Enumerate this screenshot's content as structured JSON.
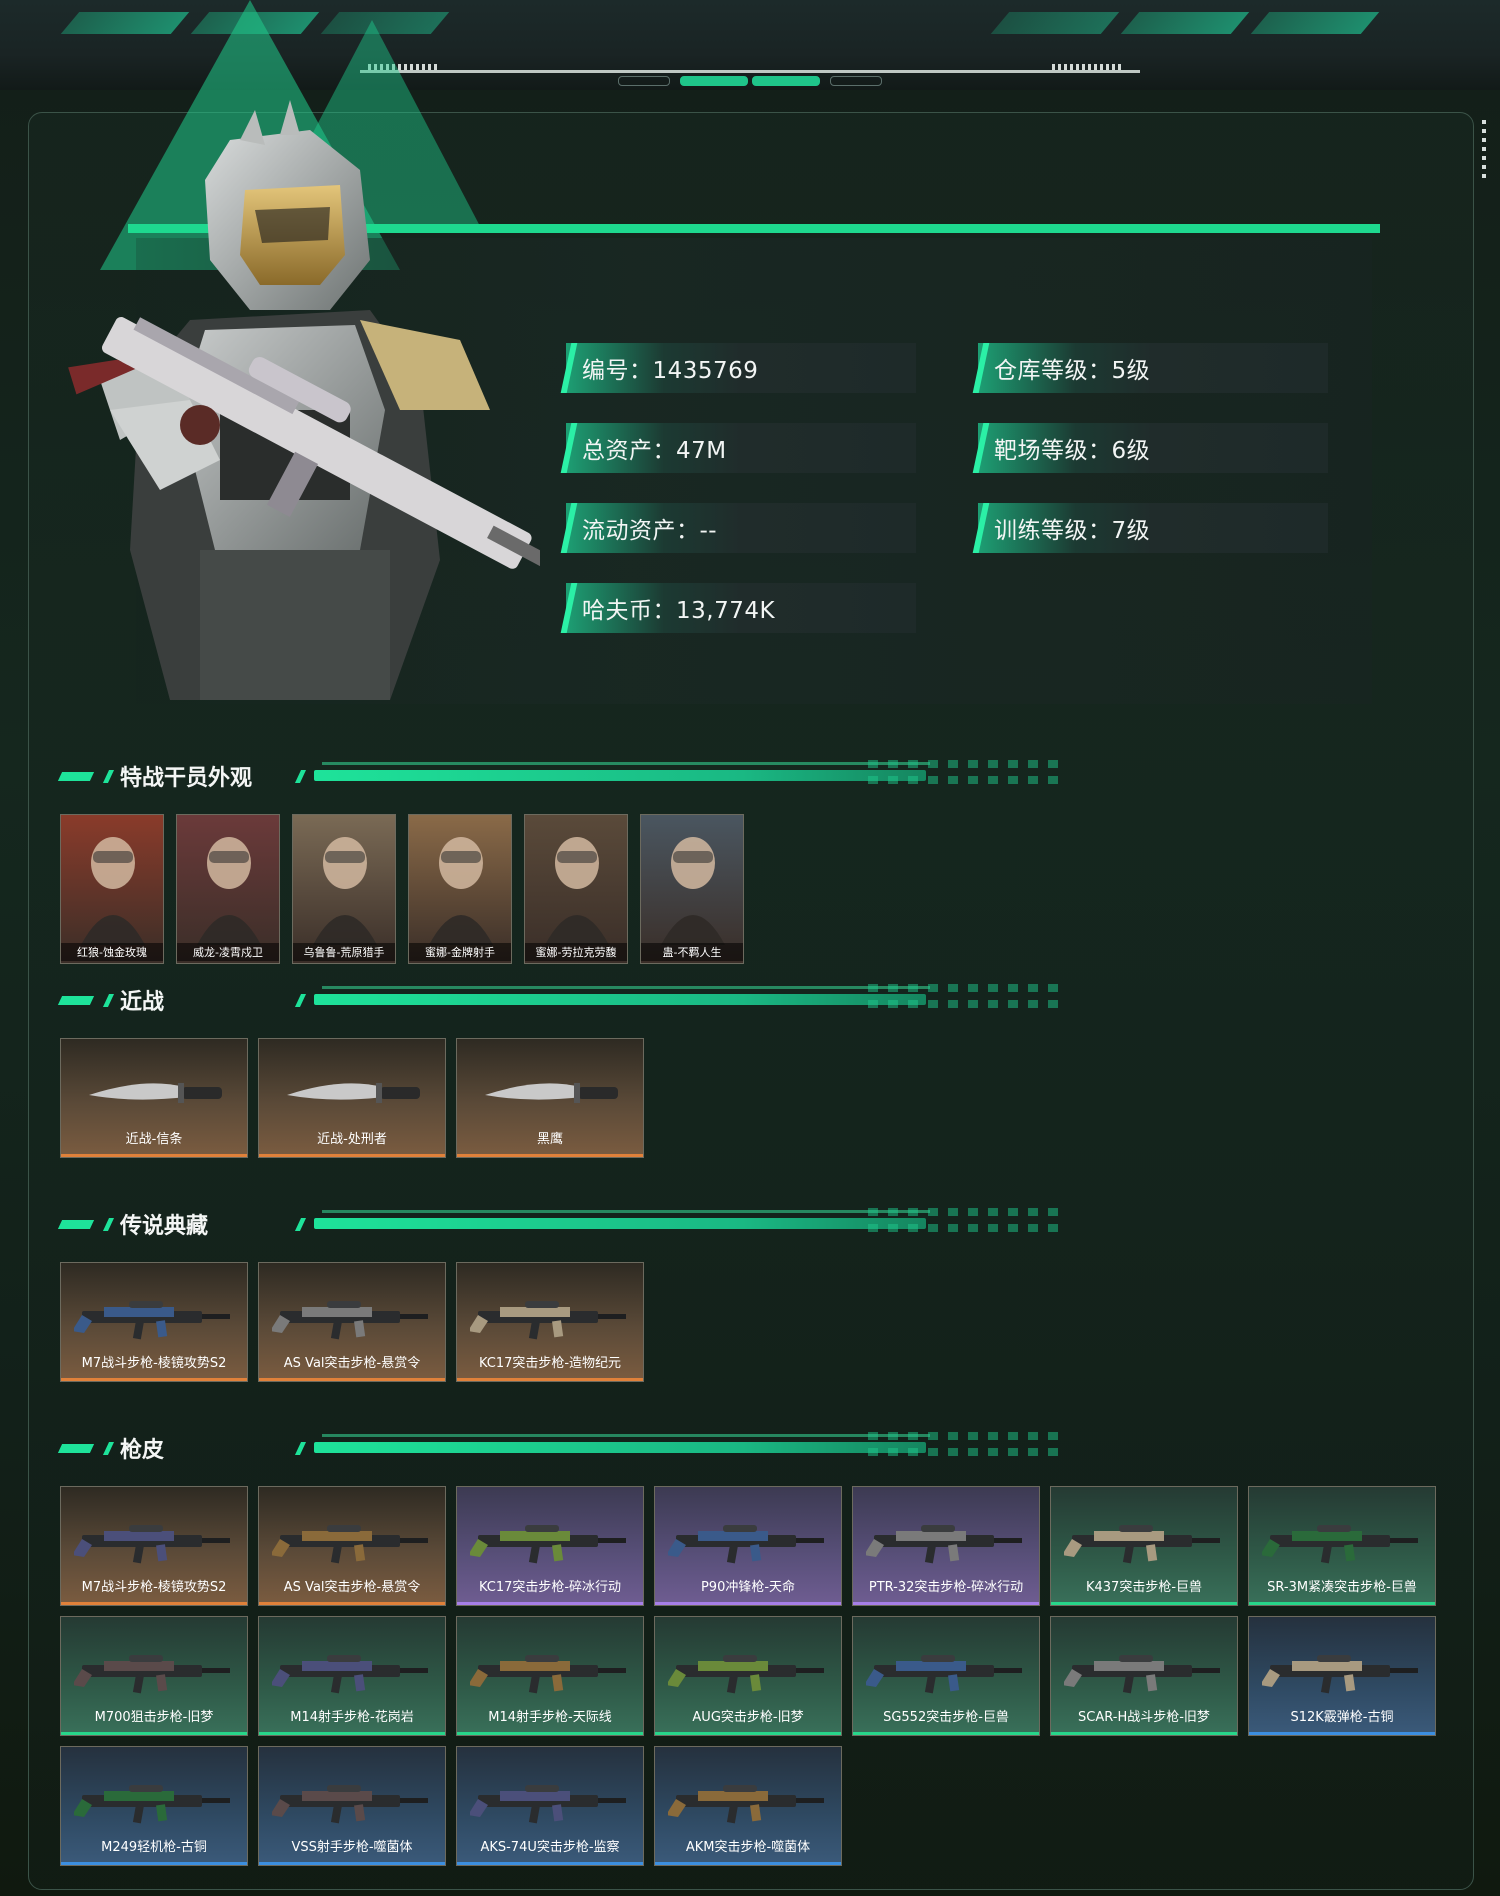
{
  "stats": {
    "id": "编号：1435769",
    "warehouse": "仓库等级：5级",
    "total_assets": "总资产：47M",
    "range": "靶场等级：6级",
    "liquid": "流动资产：--",
    "training": "训练等级：7级",
    "coins": "哈夫币：13,774K"
  },
  "sections": {
    "operators": "特战干员外观",
    "melee": "近战",
    "legend": "传说典藏",
    "skins": "枪皮"
  },
  "operators": [
    {
      "label": "红狼-蚀金玫瑰",
      "color": "#8a3b2a"
    },
    {
      "label": "威龙-凌霄戍卫",
      "color": "#6b3a3a"
    },
    {
      "label": "乌鲁鲁-荒原猎手",
      "color": "#7a6a55"
    },
    {
      "label": "蜜娜-金牌射手",
      "color": "#8a6a48"
    },
    {
      "label": "蜜娜-劳拉克劳馥",
      "color": "#5a4a3a"
    },
    {
      "label": "蛊-不羁人生",
      "color": "#4a5660"
    }
  ],
  "melee": [
    {
      "label": "近战-信条"
    },
    {
      "label": "近战-处刑者"
    },
    {
      "label": "黑鹰"
    }
  ],
  "legend": [
    {
      "label": "M7战斗步枪-棱镜攻势S2"
    },
    {
      "label": "AS Val突击步枪-悬赏令"
    },
    {
      "label": "KC17突击步枪-造物纪元"
    }
  ],
  "skins": [
    {
      "label": "M7战斗步枪-棱镜攻势S2",
      "rarity": "gold"
    },
    {
      "label": "AS Val突击步枪-悬赏令",
      "rarity": "gold"
    },
    {
      "label": "KC17突击步枪-碎冰行动",
      "rarity": "purple"
    },
    {
      "label": "P90冲锋枪-天命",
      "rarity": "purple"
    },
    {
      "label": "PTR-32突击步枪-碎冰行动",
      "rarity": "purple"
    },
    {
      "label": "K437突击步枪-巨兽",
      "rarity": "green"
    },
    {
      "label": "SR-3M紧凑突击步枪-巨兽",
      "rarity": "green"
    },
    {
      "label": "M700狙击步枪-旧梦",
      "rarity": "green"
    },
    {
      "label": "M14射手步枪-花岗岩",
      "rarity": "green"
    },
    {
      "label": "M14射手步枪-天际线",
      "rarity": "green"
    },
    {
      "label": "AUG突击步枪-旧梦",
      "rarity": "green"
    },
    {
      "label": "SG552突击步枪-巨兽",
      "rarity": "green"
    },
    {
      "label": "SCAR-H战斗步枪-旧梦",
      "rarity": "green"
    },
    {
      "label": "S12K霰弹枪-古铜",
      "rarity": "blue"
    },
    {
      "label": "M249轻机枪-古铜",
      "rarity": "blue"
    },
    {
      "label": "VSS射手步枪-噬菌体",
      "rarity": "blue"
    },
    {
      "label": "AKS-74U突击步枪-监察",
      "rarity": "blue"
    },
    {
      "label": "AKM突击步枪-噬菌体",
      "rarity": "blue"
    }
  ],
  "colors": {
    "accent": "#1ed98f",
    "gold_rarity": "#e0813a",
    "purple_rarity": "#a77fe9",
    "green_rarity": "#27d68a",
    "blue_rarity": "#3c8fe0"
  }
}
